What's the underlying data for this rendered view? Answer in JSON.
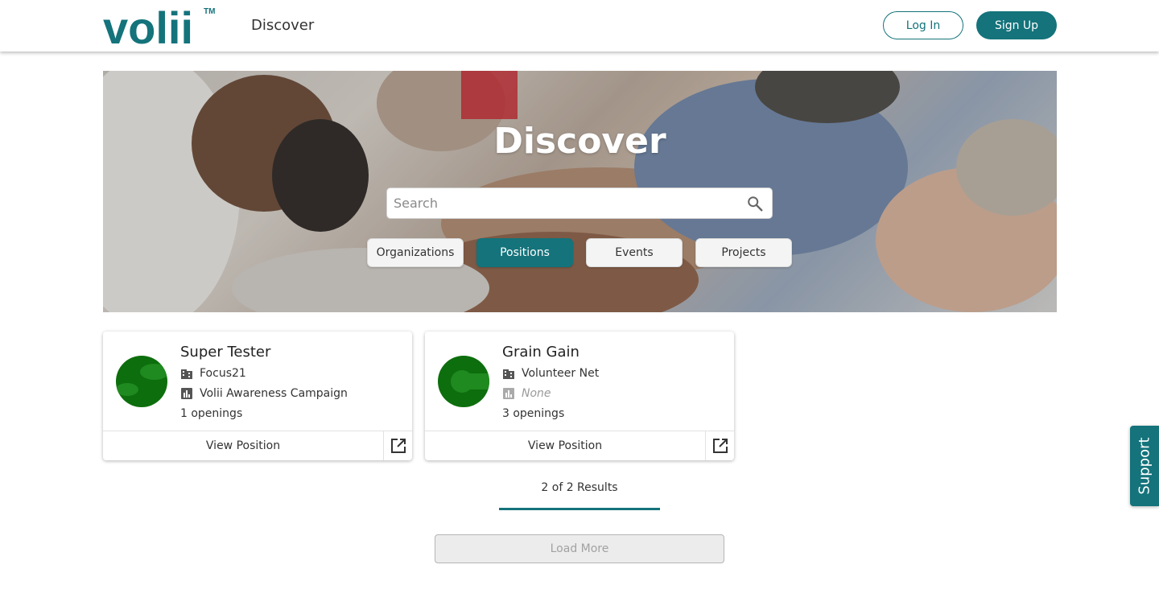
{
  "header": {
    "logo_text": "volii",
    "logo_mark": "TM",
    "nav_title": "Discover",
    "login_label": "Log In",
    "signup_label": "Sign Up"
  },
  "hero": {
    "title": "Discover",
    "search_placeholder": "Search",
    "search_value": "",
    "filters": [
      {
        "label": "Organizations",
        "active": false
      },
      {
        "label": "Positions",
        "active": true
      },
      {
        "label": "Events",
        "active": false
      },
      {
        "label": "Projects",
        "active": false
      }
    ]
  },
  "positions": [
    {
      "title": "Super Tester",
      "organization": "Focus21",
      "project": "Volii Awareness Campaign",
      "openings": "1 openings",
      "view_label": "View Position"
    },
    {
      "title": "Grain Gain",
      "organization": "Volunteer Net",
      "project": "None",
      "openings": "3 openings",
      "view_label": "View Position"
    }
  ],
  "results": {
    "summary": "2 of 2 Results",
    "load_more_label": "Load More"
  },
  "support": {
    "label": "Support"
  },
  "colors": {
    "brand": "#14737b",
    "avatar_green": "#0b6b0b",
    "muted_text": "#9a9a9a"
  },
  "icons": {
    "search": "search-icon",
    "organization": "building-icon",
    "project": "bar-chart-icon",
    "external": "open-external-icon"
  }
}
